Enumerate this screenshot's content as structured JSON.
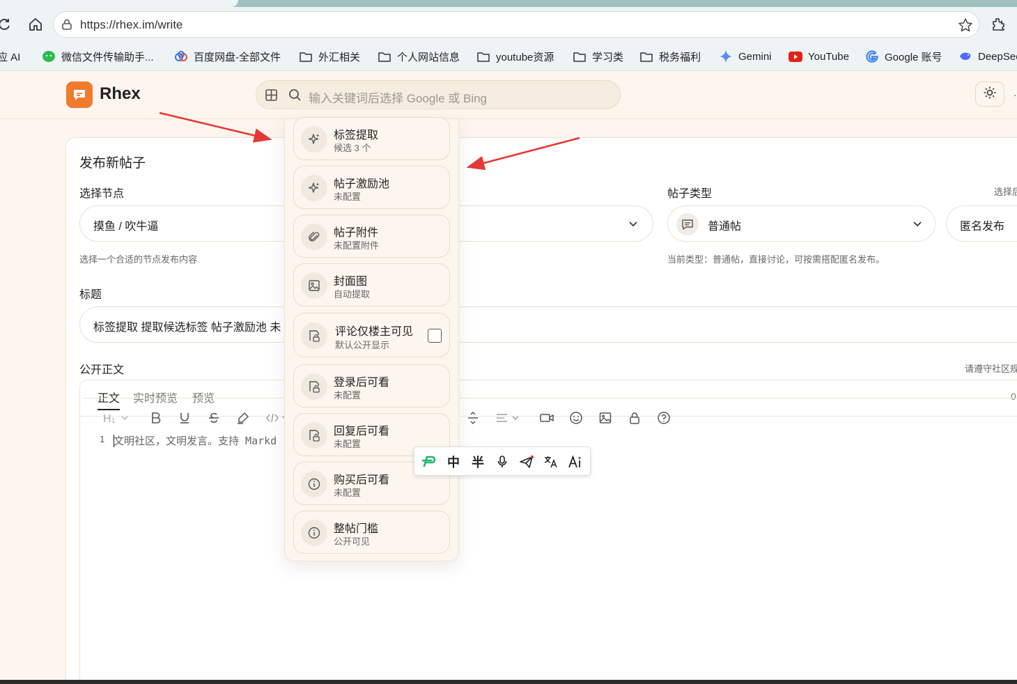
{
  "browser": {
    "url": "https://rhex.im/write",
    "bookmarks": [
      {
        "label": "应 AI",
        "icon": "ai-icon"
      },
      {
        "label": "微信文件传输助手...",
        "icon": "wechat-icon"
      },
      {
        "label": "百度网盘-全部文件",
        "icon": "baidu-netdisk-icon"
      },
      {
        "label": "外汇相关",
        "icon": "folder-icon"
      },
      {
        "label": "个人网站信息",
        "icon": "folder-icon"
      },
      {
        "label": "youtube资源",
        "icon": "folder-icon"
      },
      {
        "label": "学习类",
        "icon": "folder-icon"
      },
      {
        "label": "税务福利",
        "icon": "folder-icon"
      },
      {
        "label": "Gemini",
        "icon": "gemini-icon"
      },
      {
        "label": "YouTube",
        "icon": "youtube-icon"
      },
      {
        "label": "Google 账号",
        "icon": "google-icon"
      },
      {
        "label": "DeepSee",
        "icon": "deepseek-icon"
      }
    ]
  },
  "header": {
    "brand": "Rhex",
    "search_placeholder": "输入关键词后选择 Google 或 Bing"
  },
  "form": {
    "title": "发布新帖子",
    "node_label": "选择节点",
    "node_value": "摸鱼 / 吹牛逼",
    "node_hint": "选择一个合适的节点发布内容",
    "type_label": "帖子类型",
    "type_value": "普通帖",
    "type_hint": "当前类型：普通帖，直接讨论，可按需搭配匿名发布。",
    "anon_label": "选择后",
    "anon_value": "匿名发布",
    "subject_label": "标题",
    "subject_value": "标签提取 提取候选标签  帖子激励池 未",
    "body_label": "公开正文",
    "body_rules": "请遵守社区规",
    "editor_tabs": [
      "正文",
      "实时预览",
      "预览"
    ],
    "char_count": "0",
    "line_number": "1",
    "body_placeholder": "文明社区，文明发言。支持 Markd"
  },
  "panel": {
    "options": [
      {
        "title": "标签提取",
        "sub": "候选 3 个",
        "icon": "sparkle-icon"
      },
      {
        "title": "帖子激励池",
        "sub": "未配置",
        "icon": "sparkle-icon"
      },
      {
        "title": "帖子附件",
        "sub": "未配置附件",
        "icon": "paperclip-icon"
      },
      {
        "title": "封面图",
        "sub": "自动提取",
        "icon": "image-icon"
      },
      {
        "title": "评论仅楼主可见",
        "sub": "默认公开显示",
        "icon": "lock-doc-icon",
        "checked": false
      },
      {
        "title": "登录后可看",
        "sub": "未配置",
        "icon": "lock-doc-icon"
      },
      {
        "title": "回复后可看",
        "sub": "未配置",
        "icon": "lock-doc-icon"
      },
      {
        "title": "购买后可看",
        "sub": "未配置",
        "icon": "info-icon"
      },
      {
        "title": "整帖门槛",
        "sub": "公开可见",
        "icon": "info-icon"
      }
    ]
  },
  "ime": {
    "buttons": [
      "中",
      "半"
    ]
  },
  "colors": {
    "accent": "#f07a2d",
    "background": "#fdf6ee",
    "arrow": "#e53935"
  }
}
